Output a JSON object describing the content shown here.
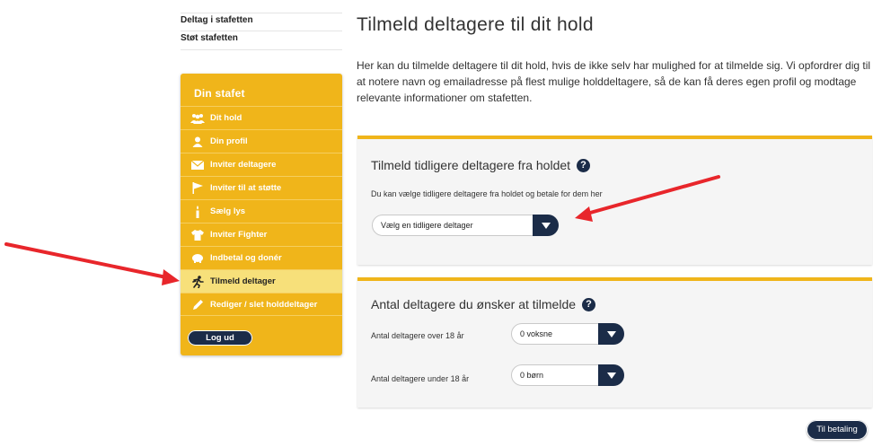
{
  "toplinks": [
    "Deltag i stafetten",
    "Støt stafetten"
  ],
  "sidebar": {
    "title": "Din stafet",
    "items": [
      {
        "label": "Dit hold",
        "icon": "group-icon"
      },
      {
        "label": "Din profil",
        "icon": "person-icon"
      },
      {
        "label": "Inviter deltagere",
        "icon": "envelope-icon"
      },
      {
        "label": "Inviter til at støtte",
        "icon": "flag-icon"
      },
      {
        "label": "Sælg lys",
        "icon": "candle-icon"
      },
      {
        "label": "Inviter Fighter",
        "icon": "tshirt-icon"
      },
      {
        "label": "Indbetal og donér",
        "icon": "piggybank-icon"
      },
      {
        "label": "Tilmeld deltager",
        "icon": "runner-icon",
        "active": true
      },
      {
        "label": "Rediger / slet holddeltager",
        "icon": "pencil-icon"
      }
    ],
    "logout_label": "Log ud"
  },
  "main": {
    "title": "Tilmeld deltagere til dit hold",
    "intro": "Her kan du tilmelde deltagere til dit hold, hvis de ikke selv har mulighed for at tilmelde sig. Vi opfordrer dig til at notere navn og emailadresse på flest mulige holddeltagere, så de kan få deres egen profil og modtage relevante informationer om stafetten."
  },
  "panel_previous": {
    "title": "Tilmeld tidligere deltagere fra holdet",
    "help": "?",
    "text": "Du kan vælge tidligere deltagere fra holdet og betale for dem her",
    "select_value": "Vælg en tidligere deltager"
  },
  "panel_count": {
    "title": "Antal deltagere du ønsker at tilmelde",
    "help": "?",
    "adults_label": "Antal deltagere over 18 år",
    "adults_value": "0 voksne",
    "children_label": "Antal deltagere under 18 år",
    "children_value": "0 børn"
  },
  "pay_button_label": "Til betaling",
  "colors": {
    "accent": "#f0b51a",
    "navy": "#1b2c48",
    "arrow": "#e8262b"
  }
}
